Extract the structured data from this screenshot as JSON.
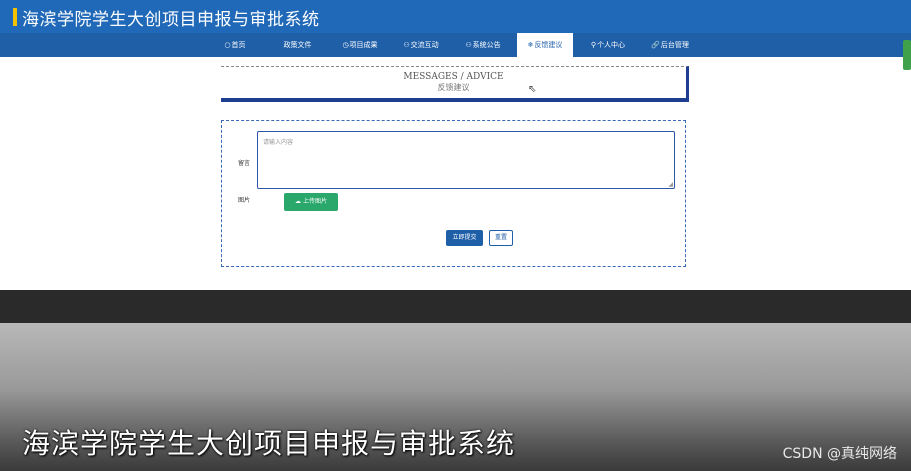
{
  "header": {
    "title": "海滨学院学生大创项目申报与审批系统"
  },
  "nav": {
    "items": [
      {
        "icon": "○",
        "label": "首页"
      },
      {
        "icon": "",
        "label": "政策文件"
      },
      {
        "icon": "◷",
        "label": "项目成果"
      },
      {
        "icon": "⚇",
        "label": "交流互动"
      },
      {
        "icon": "⚇",
        "label": "系统公告"
      },
      {
        "icon": "❄",
        "label": "反馈建议"
      },
      {
        "icon": "⚲",
        "label": "个人中心"
      },
      {
        "icon": "🔗",
        "label": "后台管理"
      }
    ],
    "active_index": 5
  },
  "banner": {
    "en": "MESSAGES / ADVICE",
    "cn": "反馈建议"
  },
  "form": {
    "message_label": "留言",
    "message_placeholder": "请输入内容",
    "image_label": "图片",
    "upload_label": "上传图片",
    "submit_label": "立即提交",
    "reset_label": "重置"
  },
  "overlay": {
    "title": "海滨学院学生大创项目申报与审批系统",
    "watermark": "CSDN @真纯网络"
  },
  "colors": {
    "header_bg": "#2069b8",
    "nav_bg": "#1f5fa8",
    "upload_btn": "#2aa86b",
    "accent": "#f2c200"
  }
}
